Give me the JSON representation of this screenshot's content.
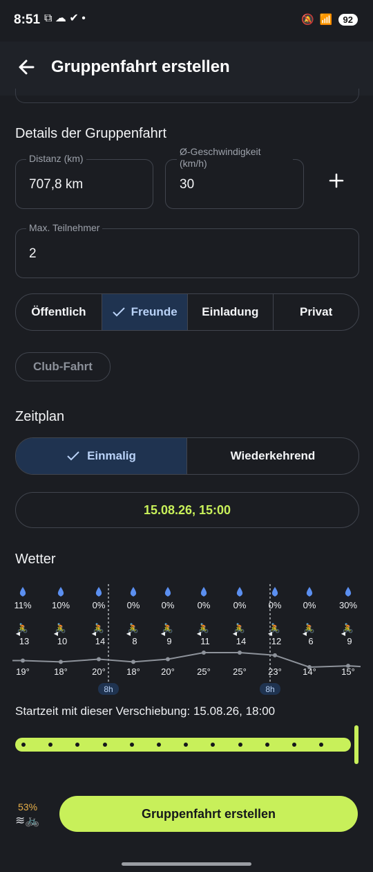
{
  "status": {
    "time": "8:51",
    "battery": "92"
  },
  "header": {
    "title": "Gruppenfahrt erstellen"
  },
  "details": {
    "title": "Details der Gruppenfahrt",
    "distance_label": "Distanz (km)",
    "distance_value": "707,8 km",
    "speed_label": "Ø-Geschwindigkeit (km/h)",
    "speed_value": "30",
    "max_label": "Max. Teilnehmer",
    "max_value": "2"
  },
  "visibility": {
    "options": [
      "Öffentlich",
      "Freunde",
      "Einladung",
      "Privat"
    ],
    "selected": "Freunde"
  },
  "club_chip": "Club-Fahrt",
  "schedule": {
    "title": "Zeitplan",
    "options": [
      "Einmalig",
      "Wiederkehrend"
    ],
    "selected": "Einmalig",
    "datetime": "15.08.26, 15:00"
  },
  "weather": {
    "title": "Wetter",
    "cells": [
      {
        "pct": "11%",
        "wind": "13",
        "temp": "19°",
        "t": 19
      },
      {
        "pct": "10%",
        "wind": "10",
        "temp": "18°",
        "t": 18
      },
      {
        "pct": "0%",
        "wind": "14",
        "temp": "20°",
        "t": 20
      },
      {
        "pct": "0%",
        "wind": "8",
        "temp": "18°",
        "t": 18
      },
      {
        "pct": "0%",
        "wind": "9",
        "temp": "20°",
        "t": 20
      },
      {
        "pct": "0%",
        "wind": "11",
        "temp": "25°",
        "t": 25
      },
      {
        "pct": "0%",
        "wind": "14",
        "temp": "25°",
        "t": 25
      },
      {
        "pct": "0%",
        "wind": "12",
        "temp": "23°",
        "t": 23
      },
      {
        "pct": "0%",
        "wind": "6",
        "temp": "14°",
        "t": 14
      },
      {
        "pct": "30%",
        "wind": "9",
        "temp": "15°",
        "t": 15
      }
    ],
    "markers": [
      "8h",
      "8h"
    ]
  },
  "shift": {
    "text": "Startzeit mit dieser Verschiebung: 15.08.26, 18:00",
    "value": 1.0
  },
  "footer": {
    "percent": "53%",
    "cta": "Gruppenfahrt erstellen"
  },
  "colors": {
    "accent": "#c8f05a",
    "selected_bg": "#1f3350",
    "rain": "#5b8ff0"
  }
}
